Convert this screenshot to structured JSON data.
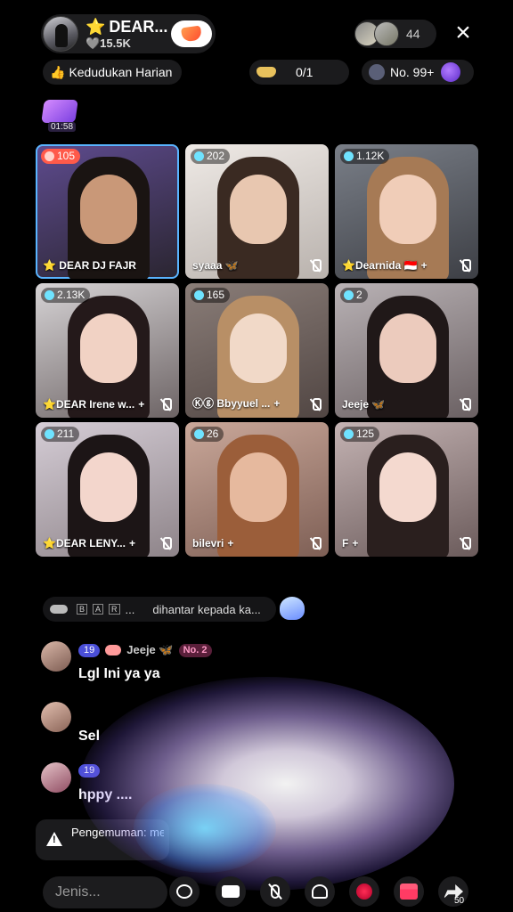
{
  "header": {
    "host_name": "DEAR...",
    "host_star": "⭐",
    "host_likes": "🩶15.5K",
    "viewer_count": "44",
    "close_icon": "×"
  },
  "subheader": {
    "daily_rank": "Kedudukan Harian",
    "goal_progress": "0/1",
    "rank_position": "No. 99+"
  },
  "timer": "01:58",
  "tiles": [
    {
      "count": "105",
      "name": "⭐ DEAR DJ FAJR",
      "plus": "",
      "muted": false,
      "hot": true,
      "bg": [
        "#5e4b8f",
        "#2a2530"
      ],
      "skin": "#c99878",
      "hair": "#1a1412"
    },
    {
      "count": "202",
      "name": "syaaa 🦋",
      "plus": "",
      "muted": true,
      "hot": false,
      "bg": [
        "#efeae6",
        "#b9b2ad"
      ],
      "skin": "#e8c7b0",
      "hair": "#3a2a22"
    },
    {
      "count": "1.12K",
      "name": "⭐Dearnida 🇮🇩",
      "plus": "+",
      "muted": true,
      "hot": false,
      "bg": [
        "#7a7f88",
        "#3d3f45"
      ],
      "skin": "#f0cdb8",
      "hair": "#a67a55"
    },
    {
      "count": "2.13K",
      "name": "⭐DEAR Irene w...",
      "plus": "+",
      "muted": true,
      "hot": false,
      "bg": [
        "#d6d3d5",
        "#6d6465"
      ],
      "skin": "#f1d2c4",
      "hair": "#24191a"
    },
    {
      "count": "165",
      "name": "Ⓚⓖ Bbyyuel ...",
      "plus": "+",
      "muted": true,
      "hot": false,
      "bg": [
        "#8a7d78",
        "#514643"
      ],
      "skin": "#f1d9c8",
      "hair": "#b88f66"
    },
    {
      "count": "2",
      "name": "Jeeje 🦋",
      "plus": "",
      "muted": true,
      "hot": false,
      "bg": [
        "#b9b2b5",
        "#6a6062"
      ],
      "skin": "#eccbbd",
      "hair": "#201818"
    },
    {
      "count": "211",
      "name": "⭐DEAR LENY...",
      "plus": "+",
      "muted": true,
      "hot": false,
      "bg": [
        "#d5cdd6",
        "#8e8489"
      ],
      "skin": "#f3d6cc",
      "hair": "#1c1516"
    },
    {
      "count": "26",
      "name": "bilevri",
      "plus": "+",
      "muted": true,
      "hot": false,
      "bg": [
        "#caa89a",
        "#7e5f55"
      ],
      "skin": "#e6b99e",
      "hair": "#9b5e3a"
    },
    {
      "count": "125",
      "name": "F",
      "plus": "+",
      "muted": true,
      "hot": false,
      "bg": [
        "#c4b3b3",
        "#6b5b5b"
      ],
      "skin": "#f4d9cf",
      "hair": "#2a1f1e"
    }
  ],
  "chat": {
    "notice_keys": [
      "B",
      "A",
      "R"
    ],
    "notice_dots": "...",
    "notice_text": "dihantar kepada ka...",
    "messages": [
      {
        "level": "19",
        "nick": "Jeeje 🦋",
        "rank": "No. 2",
        "text": "Lgl Ini ya ya",
        "avatar": [
          "#d9b7a8",
          "#7d5c52"
        ]
      },
      {
        "level": "",
        "nick": "",
        "rank": "",
        "text": "Sel",
        "avatar": [
          "#e2bfb0",
          "#8a6457"
        ]
      },
      {
        "level": "19",
        "nick": "",
        "rank": "",
        "text": "hppy ....",
        "avatar": [
          "#e5c3c8",
          "#904d63"
        ]
      }
    ],
    "system_notice": "Pengemuman: memerhati..."
  },
  "bottom": {
    "input_placeholder": "Jenis...",
    "share_count": "50"
  }
}
